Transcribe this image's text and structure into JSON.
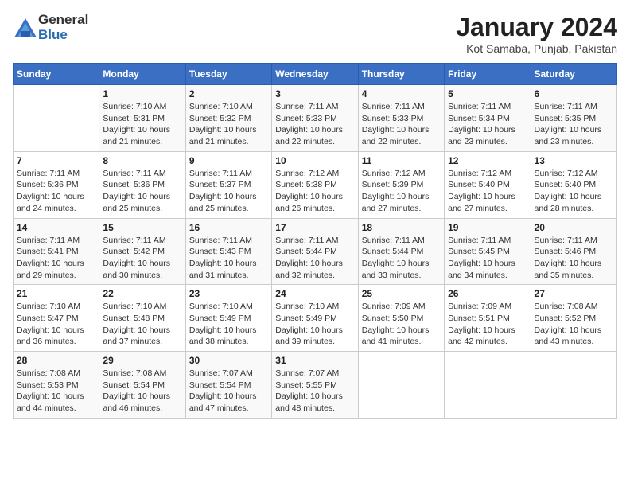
{
  "logo": {
    "general": "General",
    "blue": "Blue"
  },
  "title": "January 2024",
  "subtitle": "Kot Samaba, Punjab, Pakistan",
  "days_header": [
    "Sunday",
    "Monday",
    "Tuesday",
    "Wednesday",
    "Thursday",
    "Friday",
    "Saturday"
  ],
  "weeks": [
    [
      {
        "day": "",
        "info": ""
      },
      {
        "day": "1",
        "info": "Sunrise: 7:10 AM\nSunset: 5:31 PM\nDaylight: 10 hours\nand 21 minutes."
      },
      {
        "day": "2",
        "info": "Sunrise: 7:10 AM\nSunset: 5:32 PM\nDaylight: 10 hours\nand 21 minutes."
      },
      {
        "day": "3",
        "info": "Sunrise: 7:11 AM\nSunset: 5:33 PM\nDaylight: 10 hours\nand 22 minutes."
      },
      {
        "day": "4",
        "info": "Sunrise: 7:11 AM\nSunset: 5:33 PM\nDaylight: 10 hours\nand 22 minutes."
      },
      {
        "day": "5",
        "info": "Sunrise: 7:11 AM\nSunset: 5:34 PM\nDaylight: 10 hours\nand 23 minutes."
      },
      {
        "day": "6",
        "info": "Sunrise: 7:11 AM\nSunset: 5:35 PM\nDaylight: 10 hours\nand 23 minutes."
      }
    ],
    [
      {
        "day": "7",
        "info": "Sunrise: 7:11 AM\nSunset: 5:36 PM\nDaylight: 10 hours\nand 24 minutes."
      },
      {
        "day": "8",
        "info": "Sunrise: 7:11 AM\nSunset: 5:36 PM\nDaylight: 10 hours\nand 25 minutes."
      },
      {
        "day": "9",
        "info": "Sunrise: 7:11 AM\nSunset: 5:37 PM\nDaylight: 10 hours\nand 25 minutes."
      },
      {
        "day": "10",
        "info": "Sunrise: 7:12 AM\nSunset: 5:38 PM\nDaylight: 10 hours\nand 26 minutes."
      },
      {
        "day": "11",
        "info": "Sunrise: 7:12 AM\nSunset: 5:39 PM\nDaylight: 10 hours\nand 27 minutes."
      },
      {
        "day": "12",
        "info": "Sunrise: 7:12 AM\nSunset: 5:40 PM\nDaylight: 10 hours\nand 27 minutes."
      },
      {
        "day": "13",
        "info": "Sunrise: 7:12 AM\nSunset: 5:40 PM\nDaylight: 10 hours\nand 28 minutes."
      }
    ],
    [
      {
        "day": "14",
        "info": "Sunrise: 7:11 AM\nSunset: 5:41 PM\nDaylight: 10 hours\nand 29 minutes."
      },
      {
        "day": "15",
        "info": "Sunrise: 7:11 AM\nSunset: 5:42 PM\nDaylight: 10 hours\nand 30 minutes."
      },
      {
        "day": "16",
        "info": "Sunrise: 7:11 AM\nSunset: 5:43 PM\nDaylight: 10 hours\nand 31 minutes."
      },
      {
        "day": "17",
        "info": "Sunrise: 7:11 AM\nSunset: 5:44 PM\nDaylight: 10 hours\nand 32 minutes."
      },
      {
        "day": "18",
        "info": "Sunrise: 7:11 AM\nSunset: 5:44 PM\nDaylight: 10 hours\nand 33 minutes."
      },
      {
        "day": "19",
        "info": "Sunrise: 7:11 AM\nSunset: 5:45 PM\nDaylight: 10 hours\nand 34 minutes."
      },
      {
        "day": "20",
        "info": "Sunrise: 7:11 AM\nSunset: 5:46 PM\nDaylight: 10 hours\nand 35 minutes."
      }
    ],
    [
      {
        "day": "21",
        "info": "Sunrise: 7:10 AM\nSunset: 5:47 PM\nDaylight: 10 hours\nand 36 minutes."
      },
      {
        "day": "22",
        "info": "Sunrise: 7:10 AM\nSunset: 5:48 PM\nDaylight: 10 hours\nand 37 minutes."
      },
      {
        "day": "23",
        "info": "Sunrise: 7:10 AM\nSunset: 5:49 PM\nDaylight: 10 hours\nand 38 minutes."
      },
      {
        "day": "24",
        "info": "Sunrise: 7:10 AM\nSunset: 5:49 PM\nDaylight: 10 hours\nand 39 minutes."
      },
      {
        "day": "25",
        "info": "Sunrise: 7:09 AM\nSunset: 5:50 PM\nDaylight: 10 hours\nand 41 minutes."
      },
      {
        "day": "26",
        "info": "Sunrise: 7:09 AM\nSunset: 5:51 PM\nDaylight: 10 hours\nand 42 minutes."
      },
      {
        "day": "27",
        "info": "Sunrise: 7:08 AM\nSunset: 5:52 PM\nDaylight: 10 hours\nand 43 minutes."
      }
    ],
    [
      {
        "day": "28",
        "info": "Sunrise: 7:08 AM\nSunset: 5:53 PM\nDaylight: 10 hours\nand 44 minutes."
      },
      {
        "day": "29",
        "info": "Sunrise: 7:08 AM\nSunset: 5:54 PM\nDaylight: 10 hours\nand 46 minutes."
      },
      {
        "day": "30",
        "info": "Sunrise: 7:07 AM\nSunset: 5:54 PM\nDaylight: 10 hours\nand 47 minutes."
      },
      {
        "day": "31",
        "info": "Sunrise: 7:07 AM\nSunset: 5:55 PM\nDaylight: 10 hours\nand 48 minutes."
      },
      {
        "day": "",
        "info": ""
      },
      {
        "day": "",
        "info": ""
      },
      {
        "day": "",
        "info": ""
      }
    ]
  ]
}
